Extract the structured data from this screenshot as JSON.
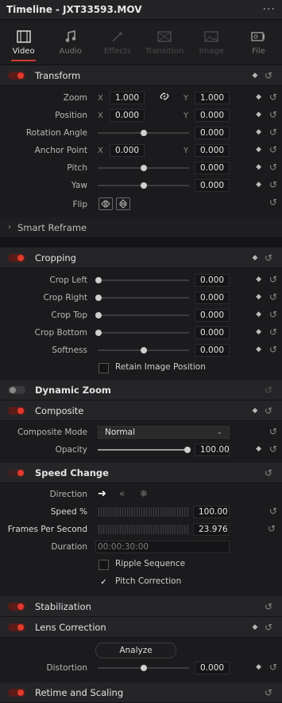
{
  "title": "Timeline - JXT33593.MOV",
  "more": "···",
  "tabs": [
    {
      "label": "Video",
      "icon": "video-icon",
      "state": "active"
    },
    {
      "label": "Audio",
      "icon": "audio-icon",
      "state": "normal"
    },
    {
      "label": "Effects",
      "icon": "effects-icon",
      "state": "disabled"
    },
    {
      "label": "Transition",
      "icon": "transition-icon",
      "state": "disabled"
    },
    {
      "label": "Image",
      "icon": "image-icon",
      "state": "disabled"
    },
    {
      "label": "File",
      "icon": "file-icon",
      "state": "normal"
    }
  ],
  "transform": {
    "title": "Transform",
    "zoom": {
      "label": "Zoom",
      "x_axis": "X",
      "x": "1.000",
      "y_axis": "Y",
      "y": "1.000"
    },
    "position": {
      "label": "Position",
      "x_axis": "X",
      "x": "0.000",
      "y_axis": "Y",
      "y": "0.000"
    },
    "rotation": {
      "label": "Rotation Angle",
      "value": "0.000"
    },
    "anchor": {
      "label": "Anchor Point",
      "x_axis": "X",
      "x": "0.000",
      "y_axis": "Y",
      "y": "0.000"
    },
    "pitch": {
      "label": "Pitch",
      "value": "0.000"
    },
    "yaw": {
      "label": "Yaw",
      "value": "0.000"
    },
    "flip": {
      "label": "Flip"
    }
  },
  "smart_reframe": {
    "title": "Smart Reframe"
  },
  "cropping": {
    "title": "Cropping",
    "crop_left": {
      "label": "Crop Left",
      "value": "0.000"
    },
    "crop_right": {
      "label": "Crop Right",
      "value": "0.000"
    },
    "crop_top": {
      "label": "Crop Top",
      "value": "0.000"
    },
    "crop_bottom": {
      "label": "Crop Bottom",
      "value": "0.000"
    },
    "softness": {
      "label": "Softness",
      "value": "0.000"
    },
    "retain": {
      "label": "Retain Image Position",
      "checked": false
    }
  },
  "dynamic_zoom": {
    "title": "Dynamic Zoom"
  },
  "composite": {
    "title": "Composite",
    "mode": {
      "label": "Composite Mode",
      "value": "Normal"
    },
    "opacity": {
      "label": "Opacity",
      "value": "100.00"
    }
  },
  "speed_change": {
    "title": "Speed Change",
    "direction": {
      "label": "Direction"
    },
    "speed": {
      "label": "Speed %",
      "value": "100.00"
    },
    "fps": {
      "label": "Frames Per Second",
      "value": "23.976"
    },
    "duration": {
      "label": "Duration",
      "value": "00:00:30:00"
    },
    "ripple": {
      "label": "Ripple Sequence",
      "checked": false
    },
    "pitch_correction": {
      "label": "Pitch Correction",
      "checked": true
    }
  },
  "stabilization": {
    "title": "Stabilization"
  },
  "lens_correction": {
    "title": "Lens Correction",
    "analyze": "Analyze",
    "distortion": {
      "label": "Distortion",
      "value": "0.000"
    }
  },
  "retime": {
    "title": "Retime and Scaling"
  },
  "glyphs": {
    "keyframe": "◆",
    "reset": "↺",
    "check": "✓",
    "chevron_right": "›",
    "chevron_down": "⌄",
    "link": "🔗",
    "dir_forward": "➜",
    "dir_reverse": "«",
    "dir_freeze": "❄"
  },
  "colors": {
    "accent": "#e23a2e",
    "panel": "#1b1b1d",
    "header": "#252528"
  }
}
